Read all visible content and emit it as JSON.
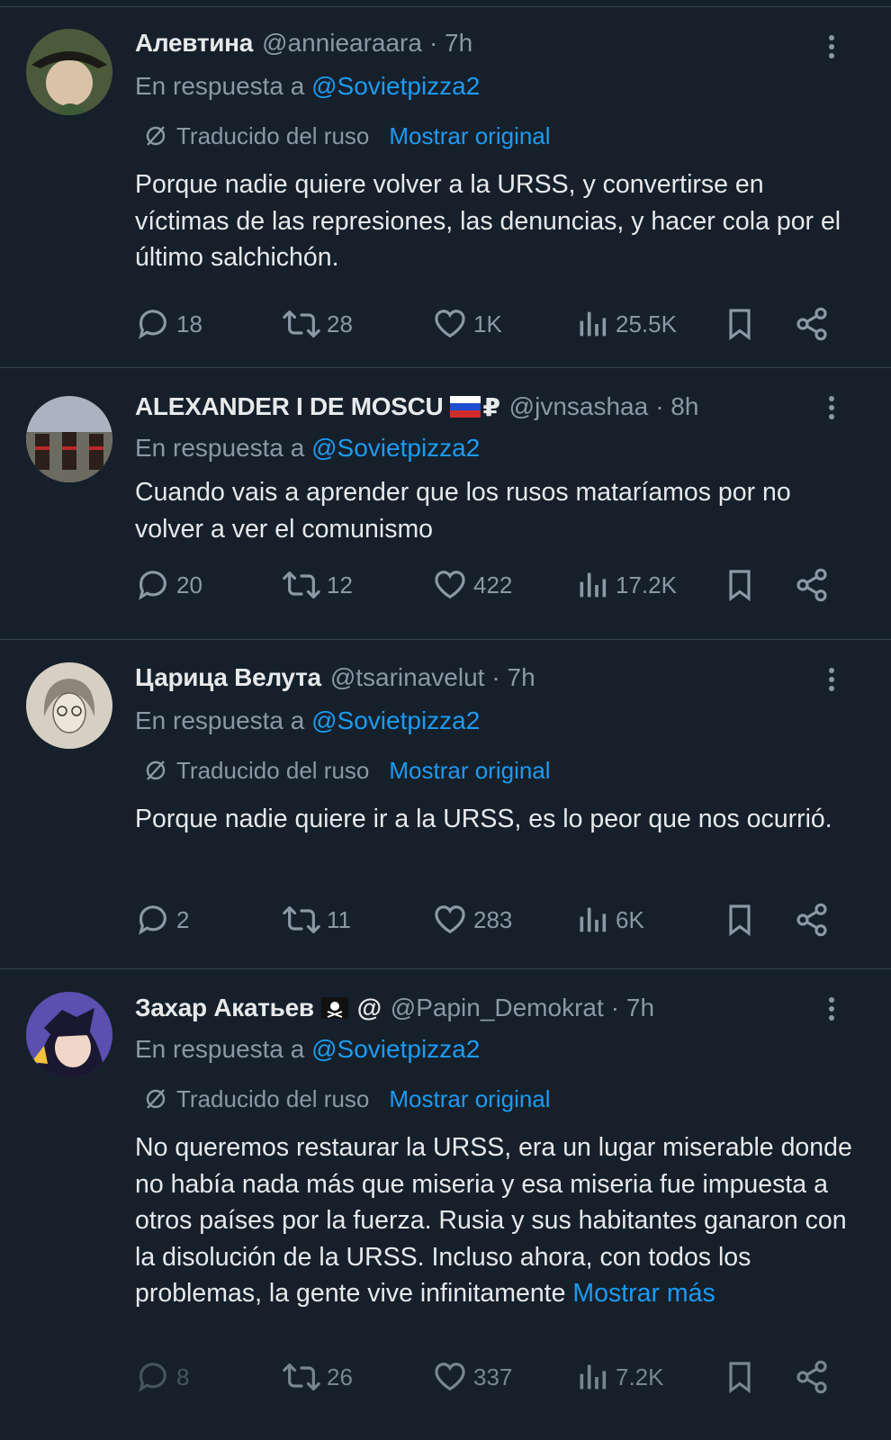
{
  "reply_prefix": "En respuesta a",
  "translate_label": "Traducido del ruso",
  "show_original": "Mostrar original",
  "show_more": "Mostrar más",
  "tweets": [
    {
      "name": "Алевтина",
      "handle": "@anniearaara",
      "time": "· 7h",
      "reply_to": "@Sovietpizza2",
      "text": "Porque nadie quiere volver a la URSS, y convertirse en víctimas de las represiones, las denuncias, y hacer cola por el último salchichón.",
      "replies": "18",
      "retweets": "28",
      "likes": "1K",
      "views": "25.5K"
    },
    {
      "name": "ALEXANDER I DE MOSCU",
      "name_suffix": "₽",
      "handle": "@jvnsashaa",
      "time": "· 8h",
      "reply_to": "@Sovietpizza2",
      "text": "Cuando vais a aprender que los rusos mataríamos por no volver a ver el comunismo",
      "replies": "20",
      "retweets": "12",
      "likes": "422",
      "views": "17.2K"
    },
    {
      "name": "Царица Велута",
      "handle": "@tsarinavelut",
      "time": "· 7h",
      "reply_to": "@Sovietpizza2",
      "text": "Porque nadie quiere ir a la URSS, es lo peor que nos ocurrió.",
      "replies": "2",
      "retweets": "11",
      "likes": "283",
      "views": "6K"
    },
    {
      "name": "Захар Акатьев",
      "name_suffix": "@",
      "handle": "@Papin_Demokrat",
      "time": "· 7h",
      "reply_to": "@Sovietpizza2",
      "text": "No queremos restaurar la URSS, era un lugar miserable donde no había nada más que miseria y esa miseria fue impuesta a otros países por la fuerza. Rusia y sus habitantes ganaron con la disolución de la URSS. Incluso ahora, con todos los problemas, la gente vive infinitamente",
      "replies": "8",
      "retweets": "26",
      "likes": "337",
      "views": "7.2K"
    }
  ]
}
